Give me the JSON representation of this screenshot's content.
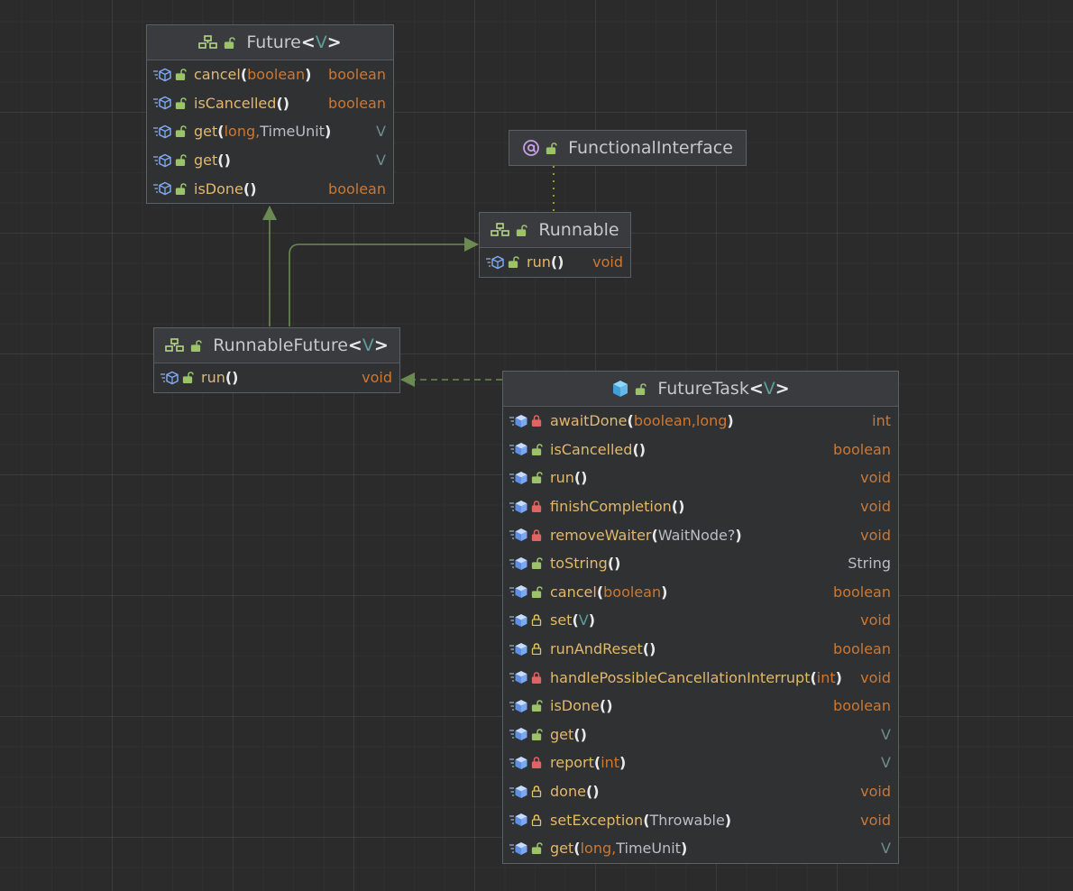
{
  "colors": {
    "background": "#2b2b2c",
    "node_fill": "#2f3133",
    "node_header": "#393b3e",
    "node_border": "#5c5f63",
    "method_name": "#e2b86b",
    "keyword_type": "#cc7832",
    "type_variable": "#5e9e9a",
    "reference_type": "#bcbec4",
    "edge": "#6a8a52"
  },
  "nodes": [
    {
      "id": "future",
      "kind": "interface",
      "name": "Future",
      "generic": "V",
      "icon": "interface-icon",
      "visibility_icon": "unlock-icon",
      "methods": [
        {
          "name": "cancel",
          "params": [
            {
              "t": "boolean",
              "k": "kw"
            }
          ],
          "ret": "boolean",
          "retk": "kw",
          "vis": "public",
          "member_icon": "abstract-method-icon"
        },
        {
          "name": "isCancelled",
          "params": [],
          "ret": "boolean",
          "retk": "kw",
          "vis": "public",
          "member_icon": "abstract-method-icon"
        },
        {
          "name": "get",
          "params": [
            {
              "t": "long",
              "k": "kw"
            },
            {
              "t": "TimeUnit",
              "k": "ref"
            }
          ],
          "ret": "V",
          "retk": "tv",
          "vis": "public",
          "member_icon": "abstract-method-icon"
        },
        {
          "name": "get",
          "params": [],
          "ret": "V",
          "retk": "tv",
          "vis": "public",
          "member_icon": "abstract-method-icon"
        },
        {
          "name": "isDone",
          "params": [],
          "ret": "boolean",
          "retk": "kw",
          "vis": "public",
          "member_icon": "abstract-method-icon"
        }
      ]
    },
    {
      "id": "functional",
      "kind": "annotation",
      "name": "FunctionalInterface",
      "generic": "",
      "icon": "annotation-icon",
      "visibility_icon": "unlock-icon",
      "methods": []
    },
    {
      "id": "runnable",
      "kind": "interface",
      "name": "Runnable",
      "generic": "",
      "icon": "interface-icon",
      "visibility_icon": "unlock-icon",
      "methods": [
        {
          "name": "run",
          "params": [],
          "ret": "void",
          "retk": "kw",
          "vis": "public",
          "member_icon": "abstract-method-icon"
        }
      ]
    },
    {
      "id": "runnablefuture",
      "kind": "interface",
      "name": "RunnableFuture",
      "generic": "V",
      "icon": "interface-icon",
      "visibility_icon": "unlock-icon",
      "methods": [
        {
          "name": "run",
          "params": [],
          "ret": "void",
          "retk": "kw",
          "vis": "public",
          "member_icon": "abstract-method-icon"
        }
      ]
    },
    {
      "id": "futuretask",
      "kind": "class",
      "name": "FutureTask",
      "generic": "V",
      "icon": "class-icon",
      "visibility_icon": "unlock-icon",
      "methods": [
        {
          "name": "awaitDone",
          "params": [
            {
              "t": "boolean",
              "k": "kw"
            },
            {
              "t": "long",
              "k": "kw"
            }
          ],
          "ret": "int",
          "retk": "kw",
          "vis": "private",
          "member_icon": "method-icon"
        },
        {
          "name": "isCancelled",
          "params": [],
          "ret": "boolean",
          "retk": "kw",
          "vis": "public",
          "member_icon": "method-icon"
        },
        {
          "name": "run",
          "params": [],
          "ret": "void",
          "retk": "kw",
          "vis": "public",
          "member_icon": "method-icon"
        },
        {
          "name": "finishCompletion",
          "params": [],
          "ret": "void",
          "retk": "kw",
          "vis": "private",
          "member_icon": "method-icon"
        },
        {
          "name": "removeWaiter",
          "params": [
            {
              "t": "WaitNode?",
              "k": "ref"
            }
          ],
          "ret": "void",
          "retk": "kw",
          "vis": "private",
          "member_icon": "method-icon"
        },
        {
          "name": "toString",
          "params": [],
          "ret": "String",
          "retk": "ref",
          "vis": "public",
          "member_icon": "method-icon"
        },
        {
          "name": "cancel",
          "params": [
            {
              "t": "boolean",
              "k": "kw"
            }
          ],
          "ret": "boolean",
          "retk": "kw",
          "vis": "public",
          "member_icon": "method-icon"
        },
        {
          "name": "set",
          "params": [
            {
              "t": "V",
              "k": "tv"
            }
          ],
          "ret": "void",
          "retk": "kw",
          "vis": "protected",
          "member_icon": "method-icon"
        },
        {
          "name": "runAndReset",
          "params": [],
          "ret": "boolean",
          "retk": "kw",
          "vis": "protected",
          "member_icon": "method-icon"
        },
        {
          "name": "handlePossibleCancellationInterrupt",
          "params": [
            {
              "t": "int",
              "k": "kw"
            }
          ],
          "ret": "void",
          "retk": "kw",
          "vis": "private",
          "member_icon": "method-icon"
        },
        {
          "name": "isDone",
          "params": [],
          "ret": "boolean",
          "retk": "kw",
          "vis": "public",
          "member_icon": "method-icon"
        },
        {
          "name": "get",
          "params": [],
          "ret": "V",
          "retk": "tv",
          "vis": "public",
          "member_icon": "method-icon"
        },
        {
          "name": "report",
          "params": [
            {
              "t": "int",
              "k": "kw"
            }
          ],
          "ret": "V",
          "retk": "tv",
          "vis": "private",
          "member_icon": "method-icon"
        },
        {
          "name": "done",
          "params": [],
          "ret": "void",
          "retk": "kw",
          "vis": "protected",
          "member_icon": "method-icon"
        },
        {
          "name": "setException",
          "params": [
            {
              "t": "Throwable",
              "k": "ref"
            }
          ],
          "ret": "void",
          "retk": "kw",
          "vis": "protected",
          "member_icon": "method-icon"
        },
        {
          "name": "get",
          "params": [
            {
              "t": "long",
              "k": "kw"
            },
            {
              "t": "TimeUnit",
              "k": "ref"
            }
          ],
          "ret": "V",
          "retk": "tv",
          "vis": "public",
          "member_icon": "method-icon"
        }
      ]
    }
  ],
  "edges": [
    {
      "from": "runnablefuture",
      "to": "future",
      "type": "extends"
    },
    {
      "from": "runnablefuture",
      "to": "runnable",
      "type": "extends"
    },
    {
      "from": "futuretask",
      "to": "runnablefuture",
      "type": "implements"
    },
    {
      "from": "runnable",
      "to": "functional",
      "type": "annotated-by"
    }
  ]
}
